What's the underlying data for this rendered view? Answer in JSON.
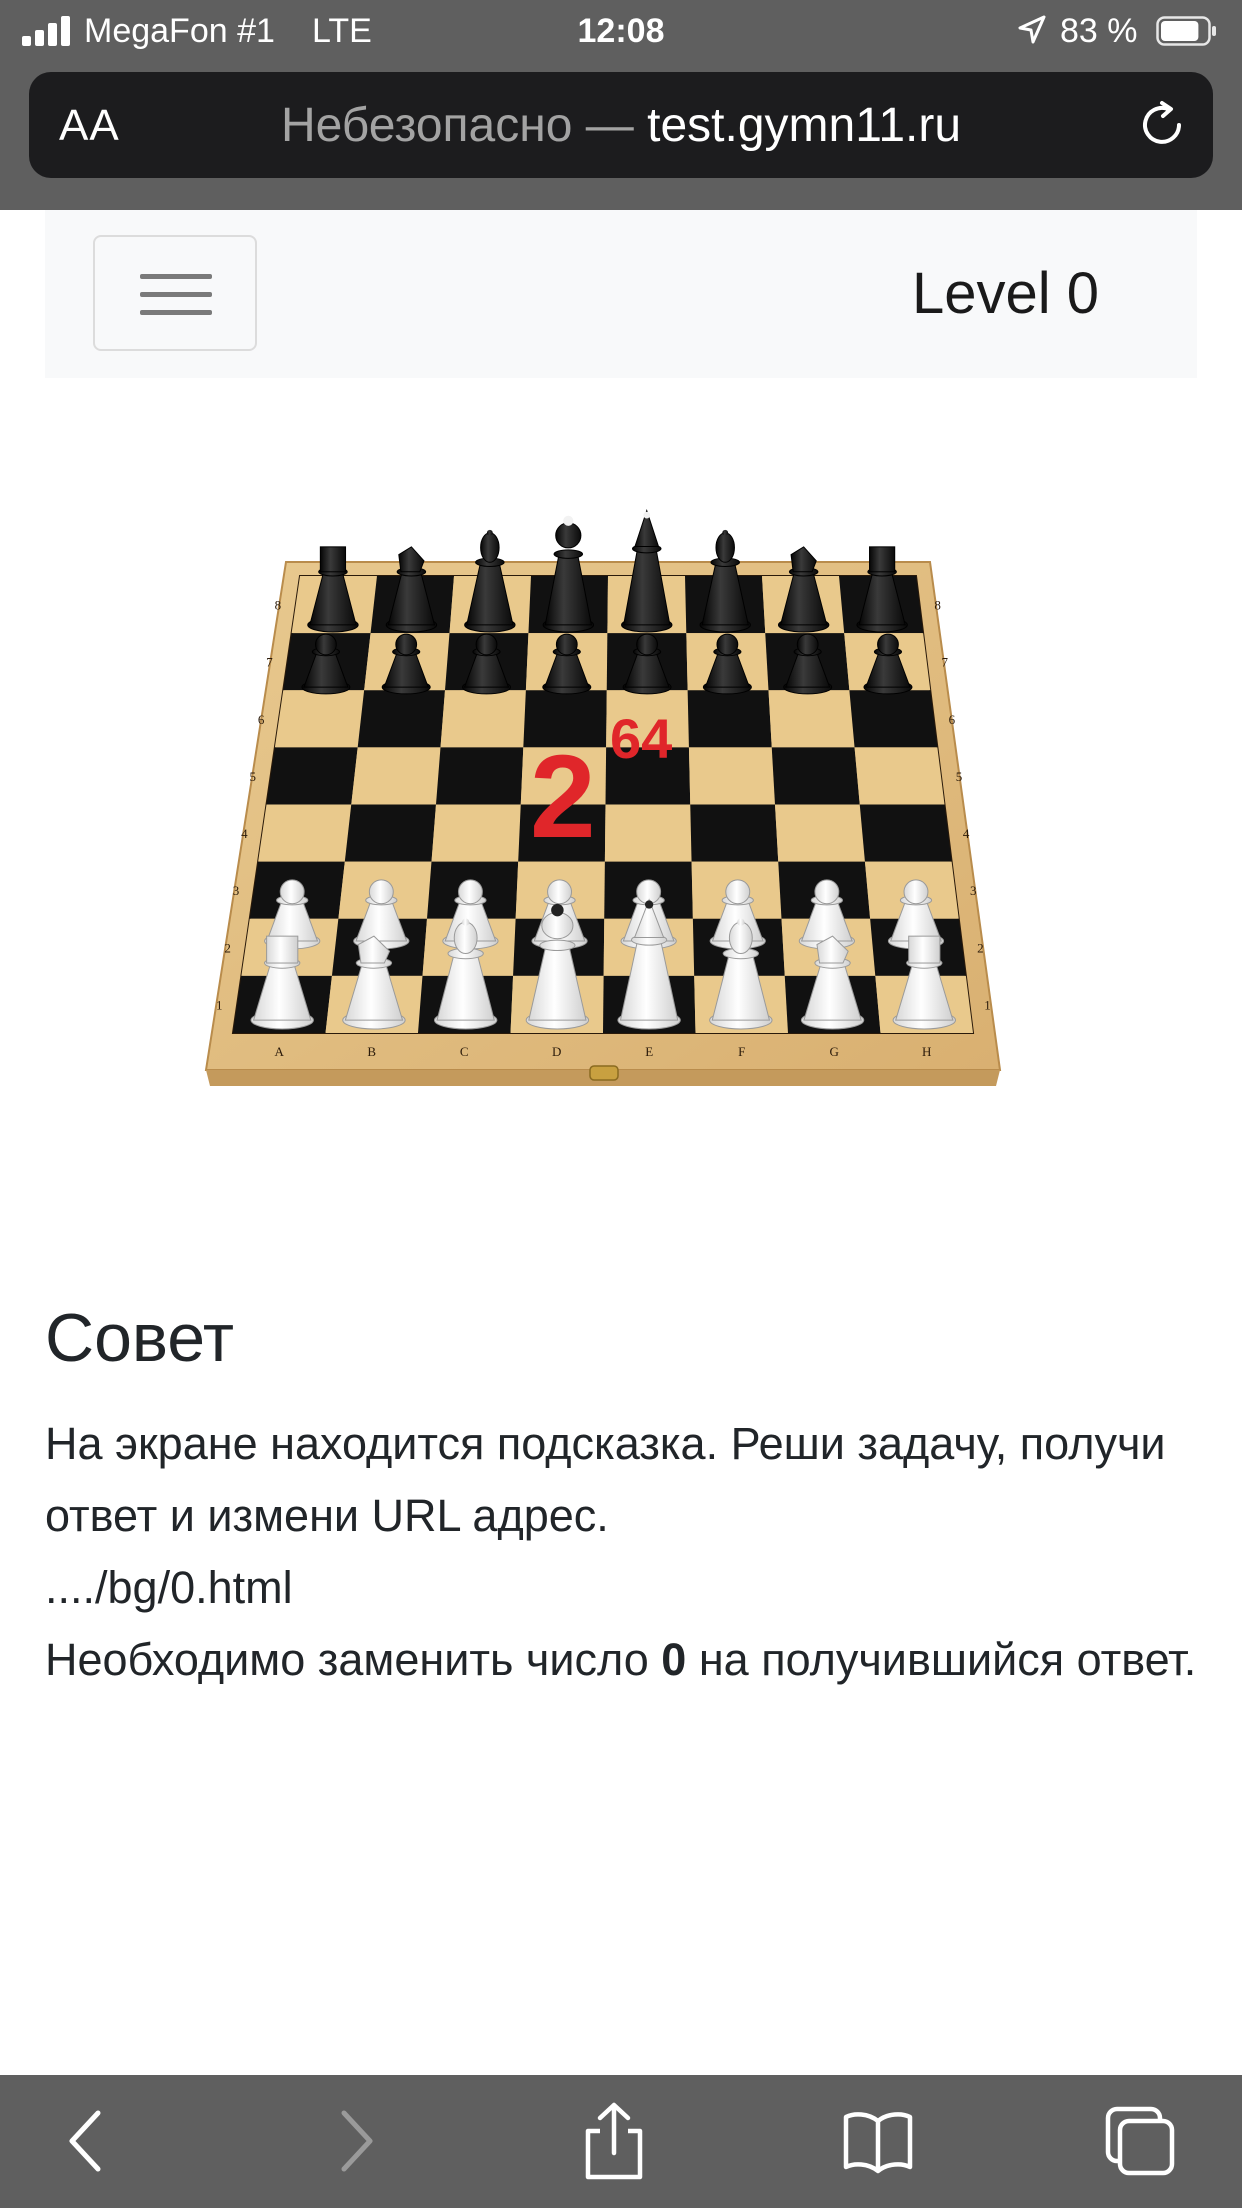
{
  "status_bar": {
    "carrier": "MegaFon #1",
    "network": "LTE",
    "time": "12:08",
    "battery_percent": "83 %",
    "battery_level": 0.83
  },
  "browser": {
    "text_size_label": "AA",
    "url_insecure_label": "Небезопасно —",
    "url_host": "test.gymn11.ru"
  },
  "navbar": {
    "brand": "Level 0"
  },
  "image": {
    "base_number": "2",
    "exponent": "64",
    "file_labels": [
      "A",
      "B",
      "C",
      "D",
      "E",
      "F",
      "G",
      "H"
    ],
    "rank_labels": [
      "8",
      "7",
      "6",
      "5",
      "4",
      "3",
      "2",
      "1"
    ]
  },
  "hint": {
    "title": "Совет",
    "line1": "На экране находится подсказка. Реши задачу, получи ответ и измени URL адрес.",
    "line2": "..../bg/0.html",
    "line3_before": "Необходимо заменить число ",
    "line3_bold": "0",
    "line3_after": " на получившийся ответ."
  },
  "colors": {
    "chrome_gray": "#5f5f5f",
    "url_bar_bg": "#1c1c1e",
    "navbar_bg": "#f8f9fa",
    "board_wood": "#e6c389",
    "dark_square": "#111111",
    "number_red": "#e0262a"
  },
  "icons": [
    "signal-icon",
    "location-arrow-icon",
    "battery-icon",
    "reload-icon",
    "hamburger-icon",
    "back-icon",
    "forward-icon",
    "share-icon",
    "bookmarks-icon",
    "tabs-icon"
  ]
}
